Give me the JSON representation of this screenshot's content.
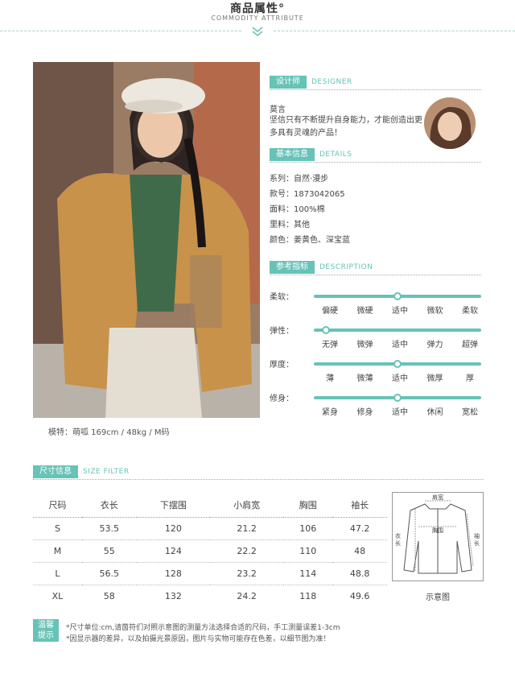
{
  "header": {
    "title": "商品属性°",
    "subtitle": "COMMODITY ATTRIBUTE"
  },
  "photo": {
    "caption": "模特：萌呱   169cm / 48kg / M码"
  },
  "designer": {
    "tag": "设计师",
    "tag_en": "DESIGNER",
    "name": "莫言",
    "quote": "坚信只有不断提升自身能力，才能创造出更多具有灵魂的产品！"
  },
  "details": {
    "tag": "基本信息",
    "tag_en": "DETAILS",
    "rows": [
      "系列：自然·漫步",
      "款号：1873042065",
      "面料：100%棉",
      "里料：其他",
      "颜色：姜黄色、深宝蓝"
    ]
  },
  "description": {
    "tag": "参考指标",
    "tag_en": "DESCRIPTION",
    "indicators": [
      {
        "label": "柔软：",
        "options": [
          "偏硬",
          "微硬",
          "适中",
          "微软",
          "柔软"
        ],
        "level": 0.5
      },
      {
        "label": "弹性：",
        "options": [
          "无弹",
          "微弹",
          "适中",
          "弹力",
          "超弹"
        ],
        "level": 0.07
      },
      {
        "label": "厚度：",
        "options": [
          "薄",
          "微薄",
          "适中",
          "微厚",
          "厚"
        ],
        "level": 0.5
      },
      {
        "label": "修身：",
        "options": [
          "紧身",
          "修身",
          "适中",
          "休闲",
          "宽松"
        ],
        "level": 0.5
      }
    ]
  },
  "size": {
    "tag": "尺寸信息",
    "tag_en": "SIZE FILTER",
    "columns": [
      "尺码",
      "衣长",
      "下摆围",
      "小肩宽",
      "胸围",
      "袖长"
    ],
    "rows": [
      [
        "S",
        "53.5",
        "120",
        "21.2",
        "106",
        "47.2"
      ],
      [
        "M",
        "55",
        "124",
        "22.2",
        "110",
        "48"
      ],
      [
        "L",
        "56.5",
        "128",
        "23.2",
        "114",
        "48.8"
      ],
      [
        "XL",
        "58",
        "132",
        "24.2",
        "118",
        "49.6"
      ]
    ],
    "diagram": {
      "caption": "示意图",
      "label_shoulder": "肩宽",
      "label_chest": "胸围",
      "label_length_1": "衣",
      "label_length_2": "长",
      "label_sleeve_1": "袖",
      "label_sleeve_2": "长"
    }
  },
  "tips": {
    "badge_1": "温馨",
    "badge_2": "提示",
    "line1": "*尺寸单位:cm,请茵符们对照示意图的测量方法选择合适的尺码，手工测量误差1-3cm",
    "line2": "*因显示器的差异，以及拍摄光景原因，图片与实物可能存在色差，以细节图为准！"
  },
  "colors": {
    "accent": "#67c2b7"
  }
}
